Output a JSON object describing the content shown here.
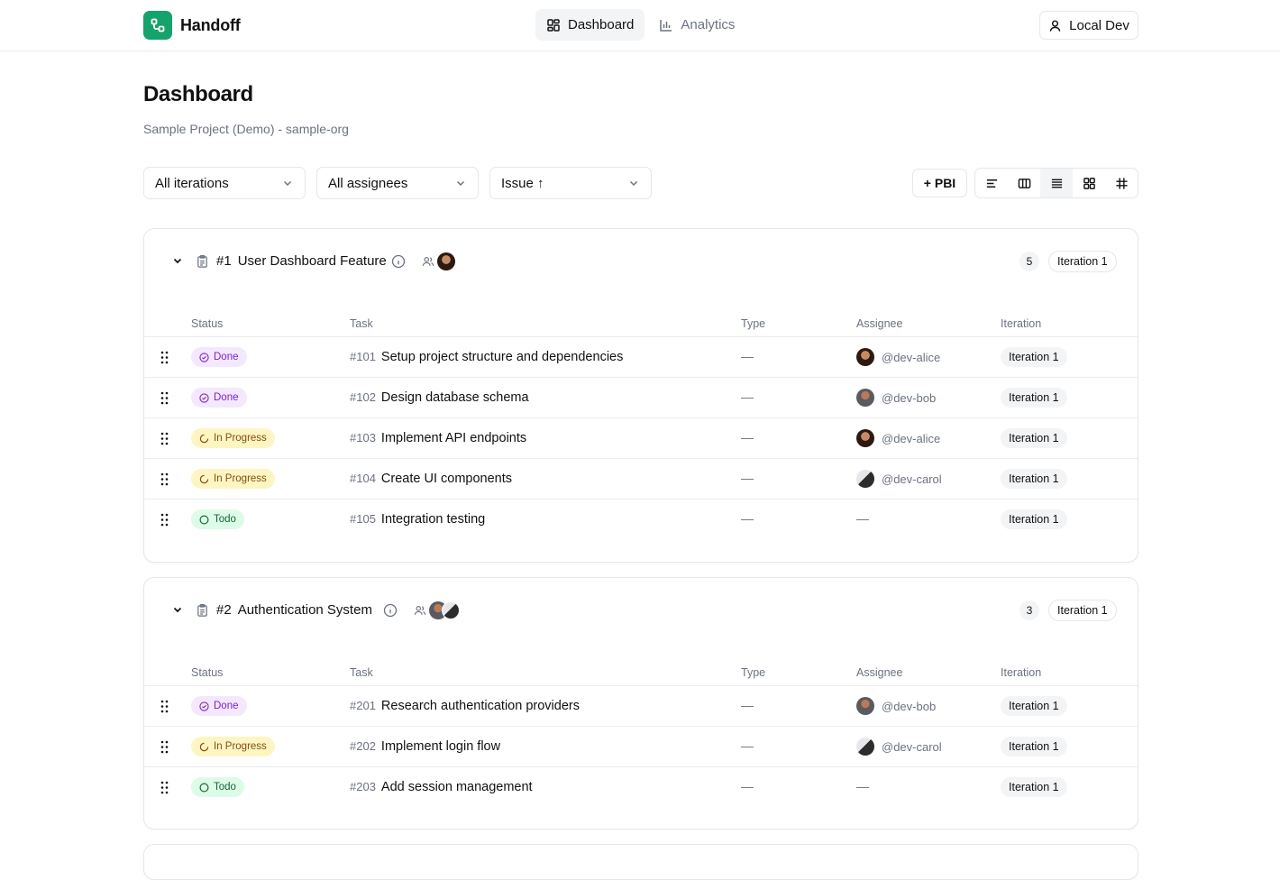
{
  "app": {
    "name": "Handoff"
  },
  "nav": [
    {
      "label": "Dashboard",
      "icon": "dashboard-icon",
      "active": true
    },
    {
      "label": "Analytics",
      "icon": "bar-chart-icon",
      "active": false
    }
  ],
  "user": {
    "label": "Local Dev",
    "icon": "user-icon"
  },
  "page": {
    "title": "Dashboard",
    "subtitle": "Sample Project (Demo) - sample-org"
  },
  "filters": {
    "iteration": "All iterations",
    "assignee": "All assignees",
    "sort": "Issue ↑"
  },
  "toolbar": {
    "add_pbi": "+ PBI",
    "views": [
      "list-lines-icon",
      "columns-icon",
      "rows-icon",
      "grid-icon",
      "table-grid-icon"
    ],
    "active_view": "rows-icon"
  },
  "colors": {
    "brand": "#16a36b",
    "done_bg": "#f3e8fd",
    "progress_bg": "#fdf6c3",
    "todo_bg": "#dcfce7"
  },
  "columns": {
    "status": "Status",
    "task": "Task",
    "type": "Type",
    "assignee": "Assignee",
    "iteration": "Iteration"
  },
  "pbis": [
    {
      "number": "#1",
      "title": "User Dashboard Feature",
      "count": "5",
      "iteration": "Iteration 1",
      "tasks": [
        {
          "status": "Done",
          "id": "#101",
          "title": "Setup project structure and dependencies",
          "type": "—",
          "assignee": "@dev-alice",
          "iteration": "Iteration 1"
        },
        {
          "status": "Done",
          "id": "#102",
          "title": "Design database schema",
          "type": "—",
          "assignee": "@dev-bob",
          "iteration": "Iteration 1"
        },
        {
          "status": "In Progress",
          "id": "#103",
          "title": "Implement API endpoints",
          "type": "—",
          "assignee": "@dev-alice",
          "iteration": "Iteration 1"
        },
        {
          "status": "In Progress",
          "id": "#104",
          "title": "Create UI components",
          "type": "—",
          "assignee": "@dev-carol",
          "iteration": "Iteration 1"
        },
        {
          "status": "Todo",
          "id": "#105",
          "title": "Integration testing",
          "type": "—",
          "assignee": "—",
          "iteration": "Iteration 1"
        }
      ]
    },
    {
      "number": "#2",
      "title": "Authentication System",
      "count": "3",
      "iteration": "Iteration 1",
      "tasks": [
        {
          "status": "Done",
          "id": "#201",
          "title": "Research authentication providers",
          "type": "—",
          "assignee": "@dev-bob",
          "iteration": "Iteration 1"
        },
        {
          "status": "In Progress",
          "id": "#202",
          "title": "Implement login flow",
          "type": "—",
          "assignee": "@dev-carol",
          "iteration": "Iteration 1"
        },
        {
          "status": "Todo",
          "id": "#203",
          "title": "Add session management",
          "type": "—",
          "assignee": "—",
          "iteration": "Iteration 1"
        }
      ]
    }
  ]
}
